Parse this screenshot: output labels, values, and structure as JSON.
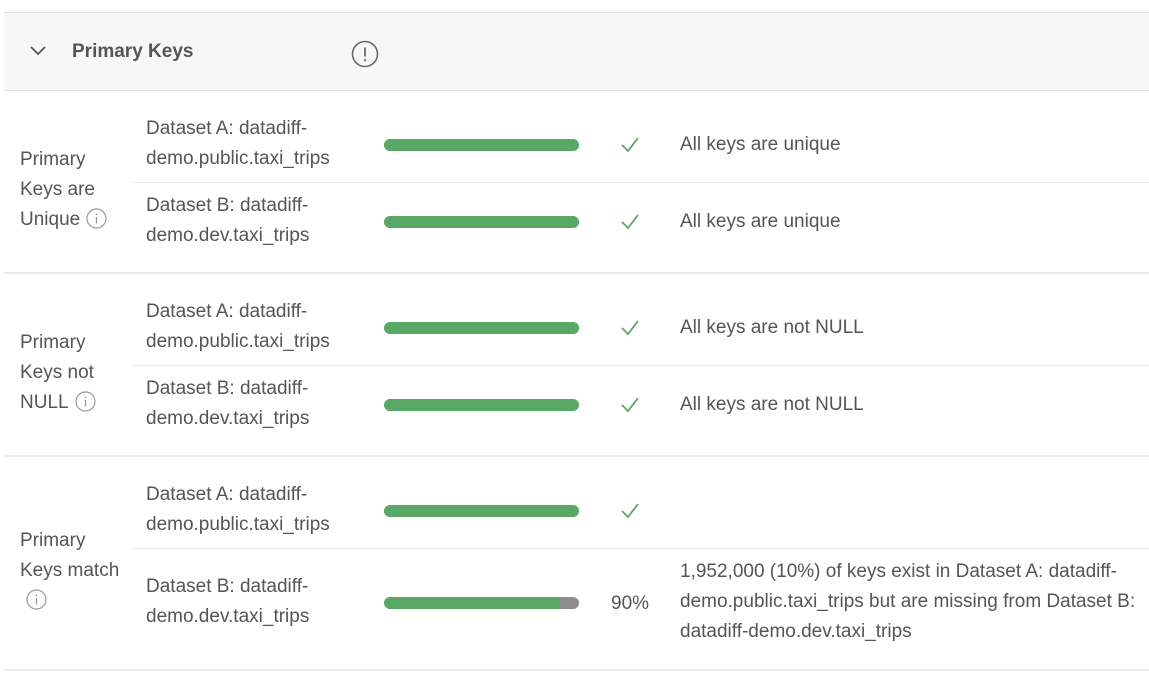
{
  "header": {
    "title": "Primary Keys",
    "collapse_icon": "chevron-down-icon",
    "warning_icon": "exclamation-circle-icon"
  },
  "colors": {
    "bar_fill": "#5aa865",
    "bar_track": "#8d8d8d",
    "check": "#5aa865",
    "header_bg": "#f7f7f7"
  },
  "groups": [
    {
      "label": "Primary Keys are Unique",
      "info_icon": "info-circle-icon",
      "rows": [
        {
          "dataset": "Dataset A: datadiff-demo.public.taxi_trips",
          "progress": 1.0,
          "status": "check",
          "percent": "",
          "message": "All keys are unique"
        },
        {
          "dataset": "Dataset B: datadiff-demo.dev.taxi_trips",
          "progress": 1.0,
          "status": "check",
          "percent": "",
          "message": "All keys are unique"
        }
      ]
    },
    {
      "label": "Primary Keys not NULL",
      "info_icon": "info-circle-icon",
      "rows": [
        {
          "dataset": "Dataset A: datadiff-demo.public.taxi_trips",
          "progress": 1.0,
          "status": "check",
          "percent": "",
          "message": "All keys are not NULL"
        },
        {
          "dataset": "Dataset B: datadiff-demo.dev.taxi_trips",
          "progress": 1.0,
          "status": "check",
          "percent": "",
          "message": "All keys are not NULL"
        }
      ]
    },
    {
      "label": "Primary Keys match",
      "info_icon": "info-circle-icon",
      "rows": [
        {
          "dataset": "Dataset A: datadiff-demo.public.taxi_trips",
          "progress": 1.0,
          "status": "check",
          "percent": "",
          "message": ""
        },
        {
          "dataset": "Dataset B: datadiff-demo.dev.taxi_trips",
          "progress": 0.9,
          "status": "percent",
          "percent": "90%",
          "message": "1,952,000 (10%) of keys exist in Dataset A: datadiff-demo.public.taxi_trips but are missing from Dataset B: datadiff-demo.dev.taxi_trips"
        }
      ]
    }
  ]
}
